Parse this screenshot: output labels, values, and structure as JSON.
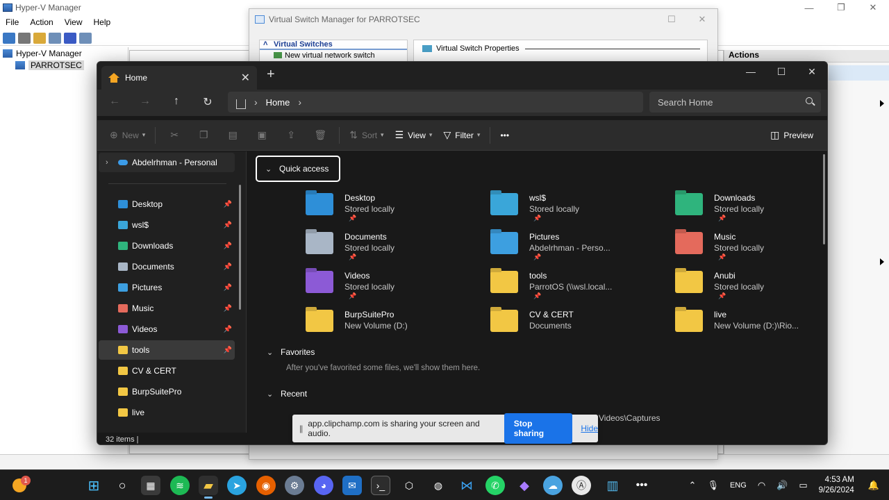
{
  "hyperv": {
    "title": "Hyper-V Manager",
    "menu": [
      "File",
      "Action",
      "View",
      "Help"
    ],
    "tree_root": "Hyper-V Manager",
    "tree_server": "PARROTSEC",
    "actions_header": "Actions",
    "win_min": "—",
    "win_max": "❐",
    "win_close": "✕"
  },
  "vsm": {
    "title": "Virtual Switch Manager for PARROTSEC",
    "section": "Virtual Switches",
    "new_switch": "New virtual network switch",
    "properties": "Virtual Switch Properties",
    "win_close": "✕",
    "win_max": "☐"
  },
  "explorer": {
    "tab_label": "Home",
    "tab_close": "✕",
    "new_tab": "+",
    "win_min": "—",
    "win_max": "☐",
    "win_close": "✕",
    "breadcrumb": "Home",
    "search_placeholder": "Search Home",
    "commands": {
      "new": "New",
      "sort": "Sort",
      "view": "View",
      "filter": "Filter",
      "more": "•••",
      "preview": "Preview"
    },
    "nav_top": "Abdelrhman - Personal",
    "nav_items": [
      {
        "label": "Desktop",
        "color": "#2e8fd8",
        "pinned": true
      },
      {
        "label": "wsl$",
        "color": "#3aa6d9",
        "pinned": true
      },
      {
        "label": "Downloads",
        "color": "#2fb47d",
        "pinned": true
      },
      {
        "label": "Documents",
        "color": "#a9b6c6",
        "pinned": true
      },
      {
        "label": "Pictures",
        "color": "#3d9fe0",
        "pinned": true
      },
      {
        "label": "Music",
        "color": "#e46a5c",
        "pinned": true
      },
      {
        "label": "Videos",
        "color": "#8c5ad6",
        "pinned": true
      },
      {
        "label": "tools",
        "color": "#f2c744",
        "pinned": true
      },
      {
        "label": "CV & CERT",
        "color": "#f2c744",
        "pinned": false
      },
      {
        "label": "BurpSuitePro",
        "color": "#f2c744",
        "pinned": false
      },
      {
        "label": "live",
        "color": "#f2c744",
        "pinned": false
      }
    ],
    "quick_access_label": "Quick access",
    "folders": [
      {
        "name": "Desktop",
        "sub": "Stored locally",
        "pinned": true,
        "color": "#2e8fd8"
      },
      {
        "name": "wsl$",
        "sub": "Stored locally",
        "pinned": true,
        "color": "#3aa6d9"
      },
      {
        "name": "Downloads",
        "sub": "Stored locally",
        "pinned": true,
        "color": "#2fb47d"
      },
      {
        "name": "Documents",
        "sub": "Stored locally",
        "pinned": true,
        "color": "#a9b6c6"
      },
      {
        "name": "Pictures",
        "sub": "Abdelrhman - Perso...",
        "pinned": true,
        "color": "#3d9fe0"
      },
      {
        "name": "Music",
        "sub": "Stored locally",
        "pinned": true,
        "color": "#e46a5c"
      },
      {
        "name": "Videos",
        "sub": "Stored locally",
        "pinned": true,
        "color": "#8c5ad6"
      },
      {
        "name": "tools",
        "sub": "ParrotOS (\\\\wsl.local...",
        "pinned": true,
        "color": "#f2c744"
      },
      {
        "name": "Anubi",
        "sub": "Stored locally",
        "pinned": true,
        "color": "#f2c744"
      },
      {
        "name": "BurpSuitePro",
        "sub": "New Volume (D:)",
        "pinned": false,
        "color": "#f2c744"
      },
      {
        "name": "CV & CERT",
        "sub": "Documents",
        "pinned": false,
        "color": "#f2c744"
      },
      {
        "name": "live",
        "sub": "New Volume (D:)\\Rio...",
        "pinned": false,
        "color": "#f2c744"
      }
    ],
    "favorites_label": "Favorites",
    "favorites_empty": "After you've favorited some files, we'll show them here.",
    "recent_label": "Recent",
    "recent_path": "Videos\\Captures",
    "status": "32 items  |"
  },
  "share_bar": {
    "grip": "||",
    "text": "app.clipchamp.com is sharing your screen and audio.",
    "stop": "Stop sharing",
    "hide": "Hide"
  },
  "taskbar": {
    "weather_badge": "1",
    "lang": "ENG",
    "time": "4:53 AM",
    "date": "9/26/2024"
  }
}
